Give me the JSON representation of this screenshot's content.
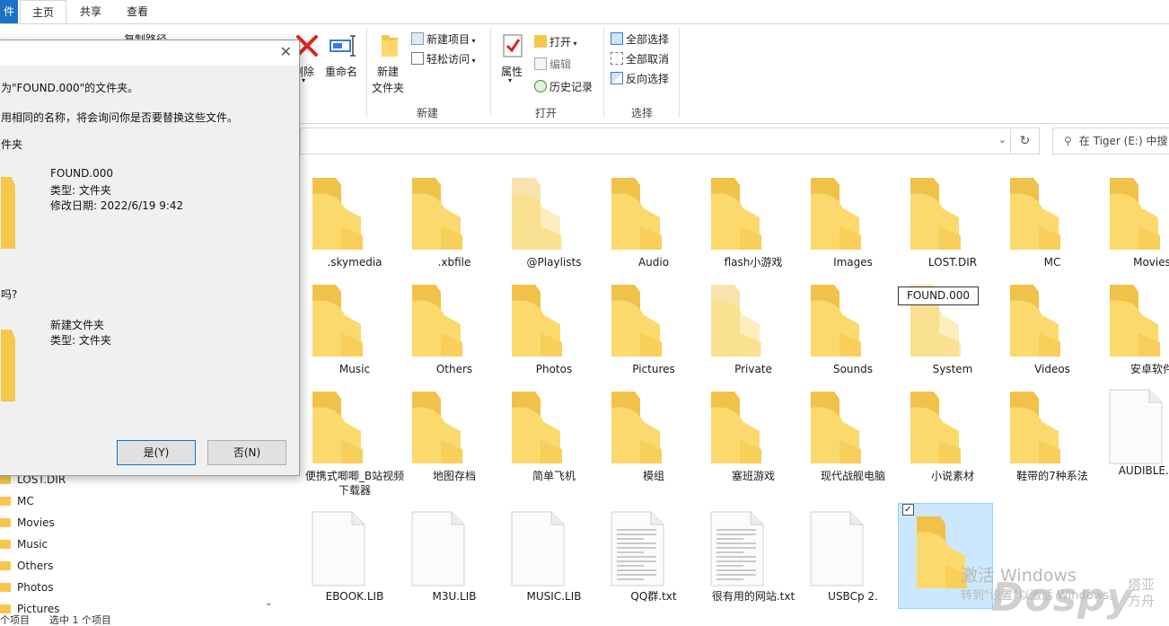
{
  "tabs": {
    "file": "件",
    "home": "主页",
    "share": "共享",
    "view": "查看"
  },
  "ribbon": {
    "copy_path": "复制路径",
    "delete": "删除",
    "rename": "重命名",
    "new_folder_line1": "新建",
    "new_folder_line2": "文件夹",
    "new_item": "新建项目",
    "easy_access": "轻松访问",
    "group_new": "新建",
    "properties": "属性",
    "open": "打开",
    "edit": "编辑",
    "history": "历史记录",
    "group_open": "打开",
    "select_all": "全部选择",
    "select_none": "全部取消",
    "invert_selection": "反向选择",
    "group_select": "选择"
  },
  "search": {
    "placeholder": "在 Tiger (E:) 中搜"
  },
  "dialog": {
    "line1": "为\"FOUND.000\"的文件夹。",
    "line2": "用相同的名称，将会询问你是否要替换这些文件。",
    "line3": "件夹",
    "existing": {
      "name": "FOUND.000",
      "type": "类型: 文件夹",
      "modified": "修改日期: 2022/6/19 9:42"
    },
    "question": "吗?",
    "incoming": {
      "name": "新建文件夹",
      "type": "类型: 文件夹"
    },
    "yes": "是(Y)",
    "no": "否(N)"
  },
  "sidebar": {
    "items": [
      "LOST.DIR",
      "MC",
      "Movies",
      "Music",
      "Others",
      "Photos",
      "Pictures"
    ]
  },
  "status": {
    "count": "个项目",
    "selected": "选中 1 个项目"
  },
  "rename_value": "FOUND.000",
  "files": [
    {
      "label": ".skymedia",
      "kind": "folder"
    },
    {
      "label": ".xbfile",
      "kind": "folder"
    },
    {
      "label": "@Playlists",
      "kind": "folder-hidden"
    },
    {
      "label": "Audio",
      "kind": "folder"
    },
    {
      "label": "flash小游戏",
      "kind": "folder"
    },
    {
      "label": "Images",
      "kind": "folder"
    },
    {
      "label": "LOST.DIR",
      "kind": "folder"
    },
    {
      "label": "MC",
      "kind": "folder"
    },
    {
      "label": "Movies",
      "kind": "folder"
    },
    {
      "label": "Music",
      "kind": "folder"
    },
    {
      "label": "Others",
      "kind": "folder"
    },
    {
      "label": "Photos",
      "kind": "folder"
    },
    {
      "label": "Pictures",
      "kind": "folder"
    },
    {
      "label": "Private",
      "kind": "folder-hidden"
    },
    {
      "label": "Sounds",
      "kind": "folder"
    },
    {
      "label": "System",
      "kind": "folder-hidden"
    },
    {
      "label": "Videos",
      "kind": "folder"
    },
    {
      "label": "安卓软件",
      "kind": "folder"
    },
    {
      "label": "便携式唧唧_B站视频下载器",
      "kind": "folder"
    },
    {
      "label": "地图存档",
      "kind": "folder"
    },
    {
      "label": "简单飞机",
      "kind": "folder"
    },
    {
      "label": "模组",
      "kind": "folder"
    },
    {
      "label": "塞班游戏",
      "kind": "folder"
    },
    {
      "label": "现代战舰电脑",
      "kind": "folder"
    },
    {
      "label": "小说素材",
      "kind": "folder"
    },
    {
      "label": "鞋带的7种系法",
      "kind": "folder"
    },
    {
      "label": "AUDIBLE.LIB",
      "kind": "file"
    },
    {
      "label": "EBOOK.LIB",
      "kind": "file"
    },
    {
      "label": "M3U.LIB",
      "kind": "file"
    },
    {
      "label": "MUSIC.LIB",
      "kind": "file"
    },
    {
      "label": "QQ群.txt",
      "kind": "text"
    },
    {
      "label": "很有用的网站.txt",
      "kind": "text"
    },
    {
      "label": "USBCp  2.",
      "kind": "file"
    },
    {
      "label": "",
      "kind": "folder-selected"
    }
  ],
  "watermark": {
    "line1": "激活 Windows",
    "line2": "转到\"设置\"以激活 Windows。",
    "brand": "Dospy",
    "brand_cn": "塔亚方舟"
  },
  "colors": {
    "accent": "#1a73c8",
    "selection": "#cce8ff",
    "folder": "#f5c84c"
  }
}
